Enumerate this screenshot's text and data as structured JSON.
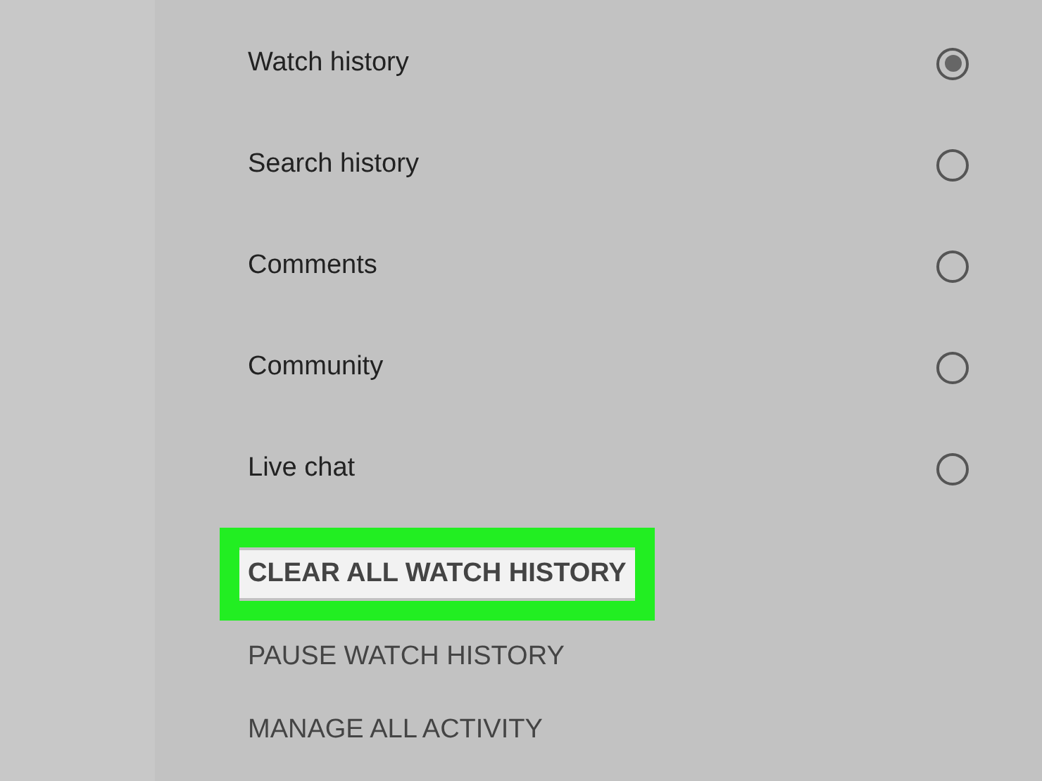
{
  "history_types": [
    {
      "label": "Watch history",
      "selected": true
    },
    {
      "label": "Search history",
      "selected": false
    },
    {
      "label": "Comments",
      "selected": false
    },
    {
      "label": "Community",
      "selected": false
    },
    {
      "label": "Live chat",
      "selected": false
    }
  ],
  "actions": [
    {
      "label": "CLEAR ALL WATCH HISTORY",
      "highlighted": true
    },
    {
      "label": "PAUSE WATCH HISTORY",
      "highlighted": false
    },
    {
      "label": "MANAGE ALL ACTIVITY",
      "highlighted": false
    }
  ]
}
